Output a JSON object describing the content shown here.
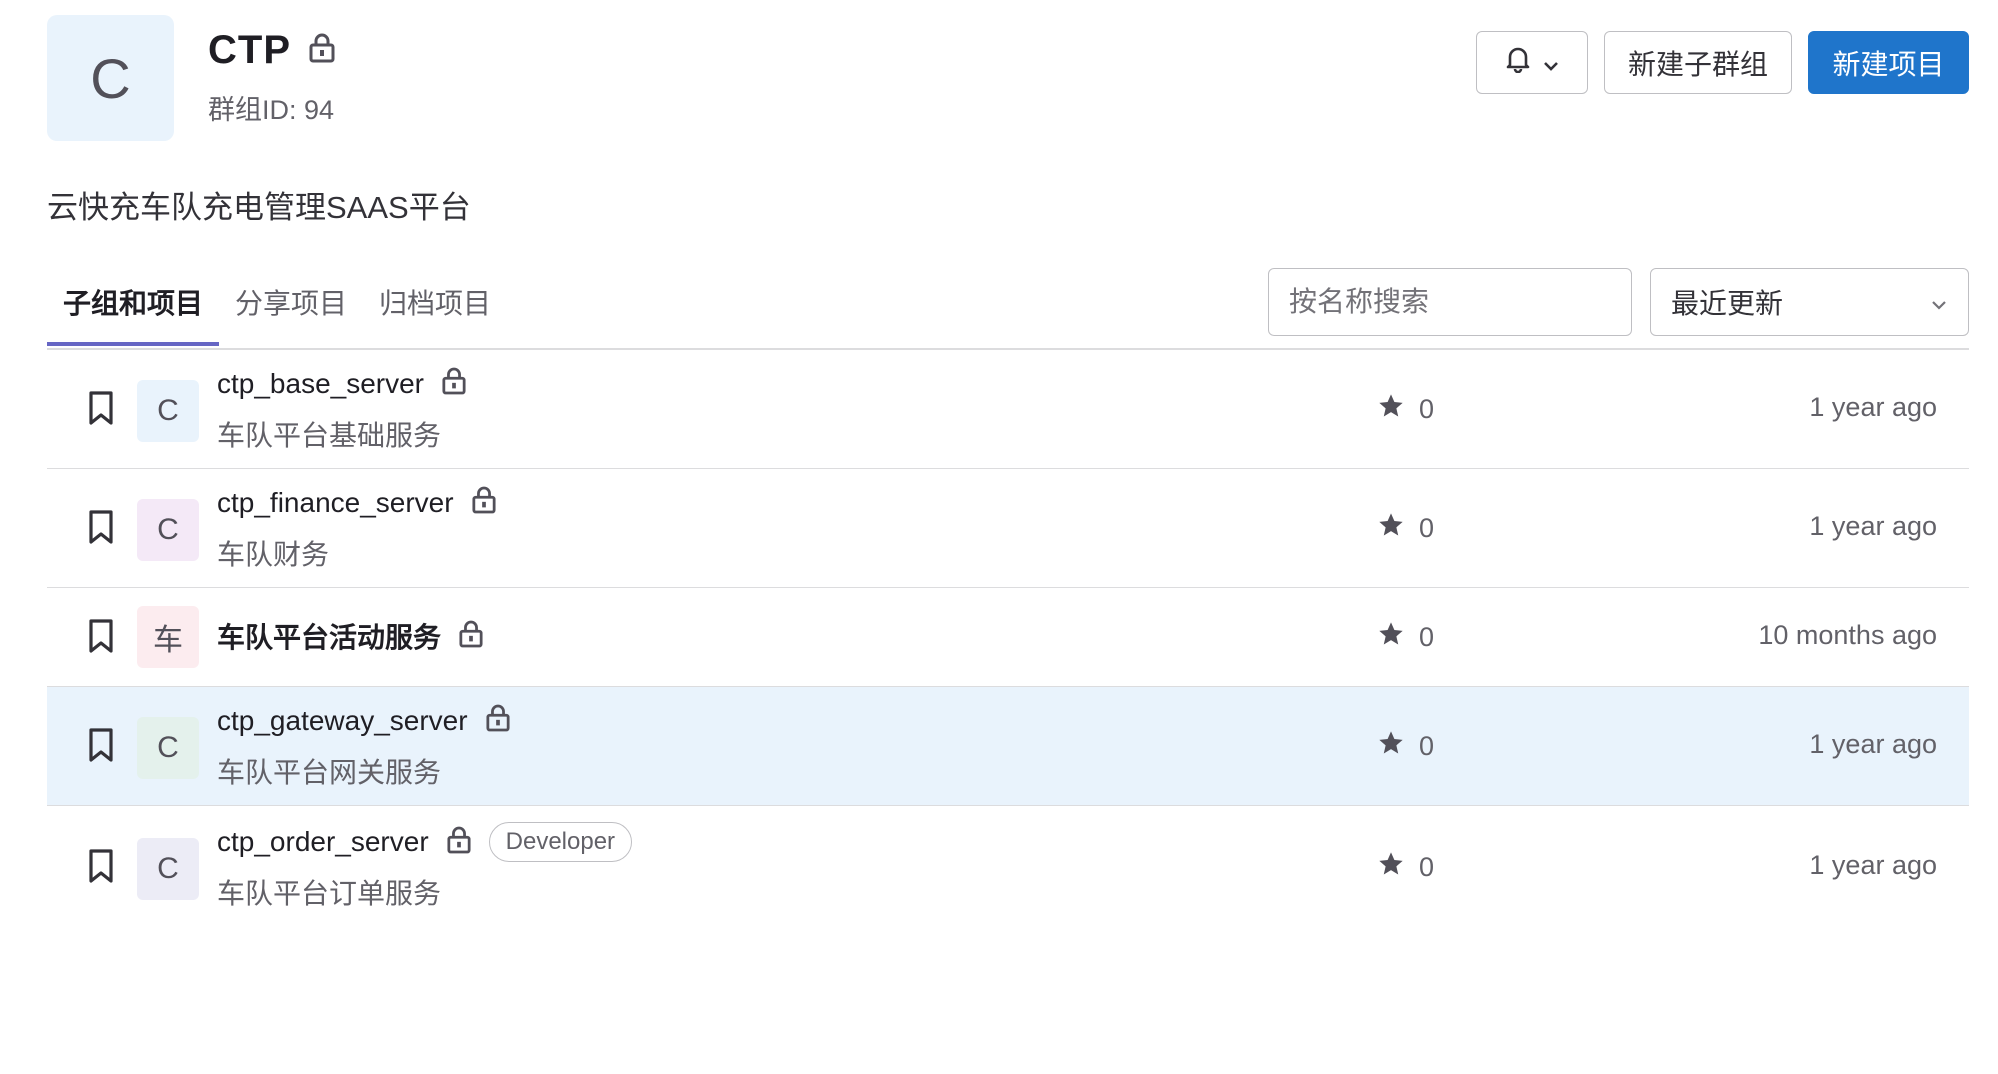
{
  "group": {
    "avatar_letter": "C",
    "name": "CTP",
    "id_text": "群组ID: 94",
    "description": "云快充车队充电管理SAAS平台"
  },
  "header_buttons": {
    "notification_icon": "bell-icon",
    "new_subgroup": "新建子群组",
    "new_project": "新建项目"
  },
  "tabs": [
    {
      "label": "子组和项目",
      "active": true
    },
    {
      "label": "分享项目",
      "active": false
    },
    {
      "label": "归档项目",
      "active": false
    }
  ],
  "search": {
    "placeholder": "按名称搜索"
  },
  "sort": {
    "selected": "最近更新"
  },
  "projects": [
    {
      "letter": "C",
      "avatar_color": "#e9f3fc",
      "name": "ctp_base_server",
      "name_bold": false,
      "description": "车队平台基础服务",
      "stars": "0",
      "updated": "1 year ago",
      "role": "",
      "highlight": false
    },
    {
      "letter": "C",
      "avatar_color": "#f4e9f7",
      "name": "ctp_finance_server",
      "name_bold": false,
      "description": "车队财务",
      "stars": "0",
      "updated": "1 year ago",
      "role": "",
      "highlight": false
    },
    {
      "letter": "车",
      "avatar_color": "#fcecef",
      "name": "车队平台活动服务",
      "name_bold": true,
      "description": "",
      "stars": "0",
      "updated": "10 months ago",
      "role": "",
      "highlight": false
    },
    {
      "letter": "C",
      "avatar_color": "#e4f1ec",
      "name": "ctp_gateway_server",
      "name_bold": false,
      "description": "车队平台网关服务",
      "stars": "0",
      "updated": "1 year ago",
      "role": "",
      "highlight": true
    },
    {
      "letter": "C",
      "avatar_color": "#ececf6",
      "name": "ctp_order_server",
      "name_bold": false,
      "description": "车队平台订单服务",
      "stars": "0",
      "updated": "1 year ago",
      "role": "Developer",
      "highlight": false
    }
  ],
  "colors": {
    "primary": "#1f75cb",
    "active_tab_underline": "#6666c4",
    "row_highlight": "#e9f3fc"
  }
}
